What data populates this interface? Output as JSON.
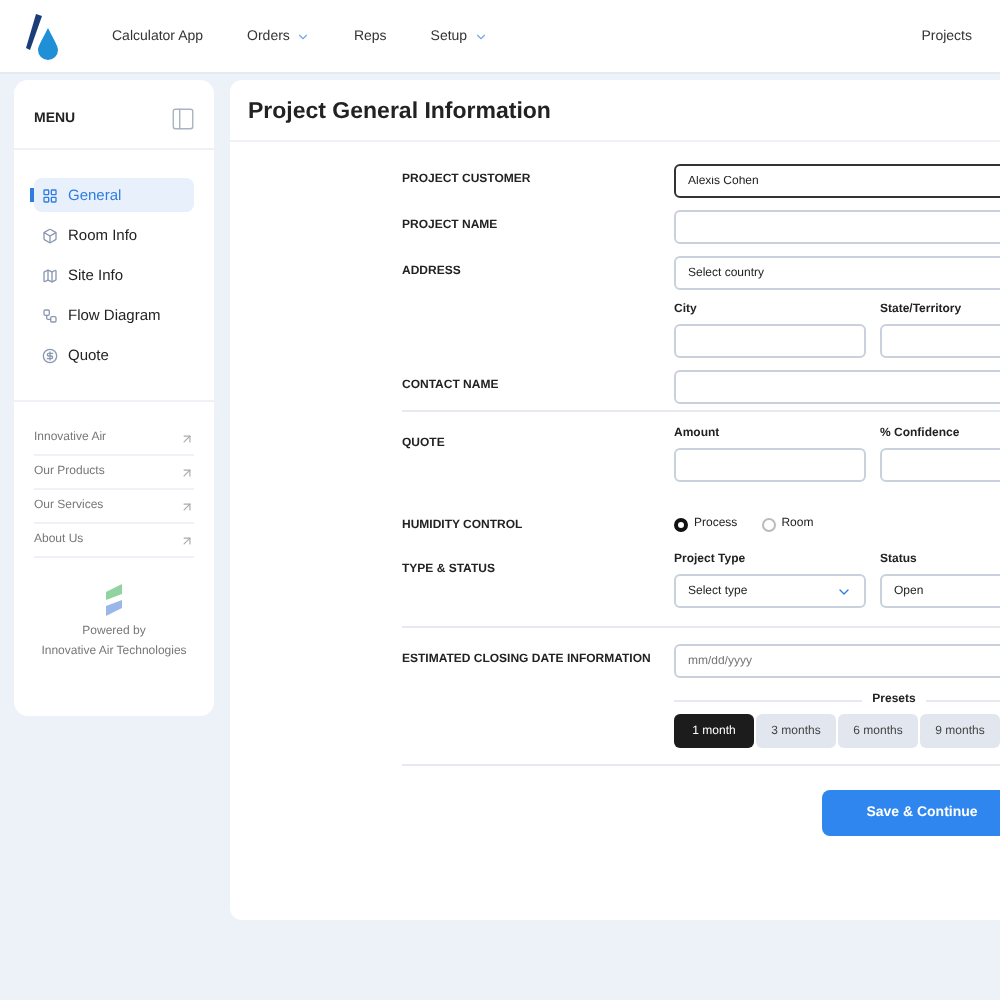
{
  "header": {
    "nav": [
      {
        "label": "Calculator App",
        "dropdown": false
      },
      {
        "label": "Orders",
        "dropdown": true
      },
      {
        "label": "Reps",
        "dropdown": false
      },
      {
        "label": "Setup",
        "dropdown": true
      }
    ],
    "right_link": "Projects"
  },
  "sidebar": {
    "title": "MENU",
    "items": [
      {
        "label": "General",
        "selected": true
      },
      {
        "label": "Room Info",
        "selected": false
      },
      {
        "label": "Site Info",
        "selected": false
      },
      {
        "label": "Flow Diagram",
        "selected": false
      },
      {
        "label": "Quote",
        "selected": false
      }
    ],
    "links": [
      "Innovative Air",
      "Our Products",
      "Our Services",
      "About Us"
    ],
    "powered_by": "Powered by",
    "company": "Innovative Air Technologies"
  },
  "form": {
    "title": "Project General Information",
    "customer": {
      "label": "PROJECT CUSTOMER",
      "value": "Alexis Cohen"
    },
    "project_name": {
      "label": "PROJECT NAME"
    },
    "address": {
      "label": "ADDRESS",
      "country_placeholder": "Select country",
      "city_label": "City",
      "state_label": "State/Territory"
    },
    "contact": {
      "label": "CONTACT NAME"
    },
    "quote": {
      "label": "QUOTE",
      "amount_label": "Amount",
      "confidence_label": "% Confidence"
    },
    "humidity": {
      "label": "HUMIDITY CONTROL",
      "options": [
        {
          "label": "Process",
          "selected": true
        },
        {
          "label": "Room",
          "selected": false
        }
      ]
    },
    "type_status": {
      "label": "TYPE & STATUS",
      "type_label": "Project Type",
      "type_placeholder": "Select type",
      "status_label": "Status",
      "status_value": "Open"
    },
    "closing": {
      "label": "ESTIMATED CLOSING DATE INFORMATION",
      "placeholder": "mm/dd/yyyy",
      "presets_label": "Presets",
      "presets": [
        {
          "label": "1 month",
          "selected": true
        },
        {
          "label": "3 months",
          "selected": false
        },
        {
          "label": "6 months",
          "selected": false
        },
        {
          "label": "9 months",
          "selected": false
        }
      ]
    },
    "submit": "Save & Continue"
  }
}
